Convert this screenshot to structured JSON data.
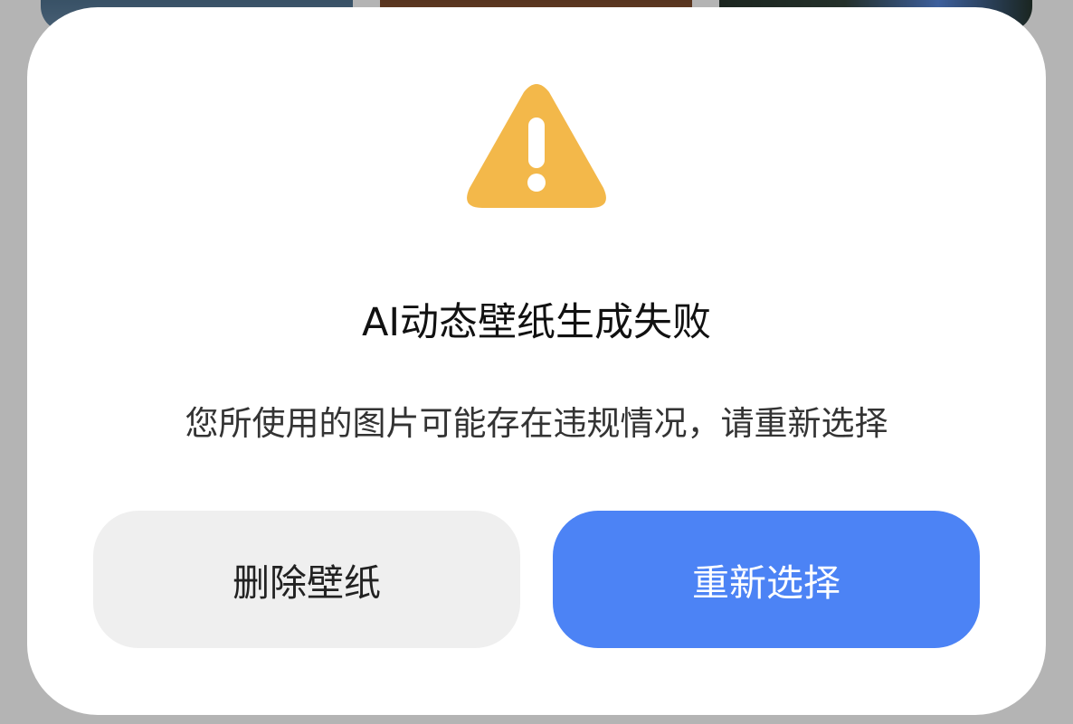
{
  "background": {
    "thumbnails": [
      "wallpaper-thumbnail-1",
      "wallpaper-thumbnail-2",
      "wallpaper-thumbnail-3"
    ]
  },
  "dialog": {
    "icon": "warning-icon",
    "icon_color": "#F3B84A",
    "title": "AI动态壁纸生成失败",
    "message": "您所使用的图片可能存在违规情况，请重新选择",
    "buttons": {
      "delete_label": "删除壁纸",
      "reselect_label": "重新选择"
    },
    "colors": {
      "primary_button": "#4C83F5",
      "secondary_button": "#EFEFEF"
    }
  }
}
